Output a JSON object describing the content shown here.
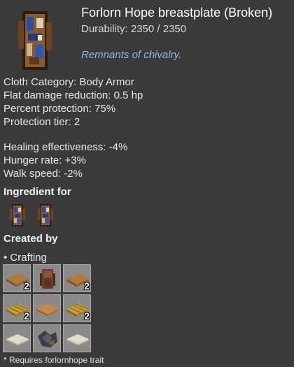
{
  "item": {
    "name": "Forlorn Hope breastplate (Broken)",
    "durability": "Durability: 2350 / 2350",
    "flavor": "Remnants of chivalry.",
    "icon": "breastplate-icon"
  },
  "stats": [
    "Cloth Category: Body Armor",
    "Flat damage reduction: 0.5 hp",
    "Percent protection: 75%",
    "Protection tier: 2",
    "Healing effectiveness: -4%",
    "Hunger rate: +3%",
    "Walk speed: -2%"
  ],
  "ingredient_for": {
    "heading": "Ingredient for",
    "items": [
      "breastplate-icon",
      "breastplate-icon"
    ]
  },
  "created_by": {
    "heading": "Created by",
    "method": "• Crafting",
    "grid": [
      {
        "icon": "plank-icon",
        "count": "2"
      },
      {
        "icon": "backpack-icon",
        "count": ""
      },
      {
        "icon": "plank-icon",
        "count": "2"
      },
      {
        "icon": "hay-bale-icon",
        "count": "2"
      },
      {
        "icon": "board-icon",
        "count": ""
      },
      {
        "icon": "hay-bale-icon",
        "count": "2"
      },
      {
        "icon": "cloth-icon",
        "count": ""
      },
      {
        "icon": "scrap-metal-icon",
        "count": ""
      },
      {
        "icon": "cloth-icon",
        "count": ""
      }
    ]
  },
  "footnote": "* Requires forlornhope trait",
  "colors": {
    "background": "#3a3a3a",
    "flavor_text": "#8fb5e8",
    "slot_background": "#8a8a8a"
  }
}
